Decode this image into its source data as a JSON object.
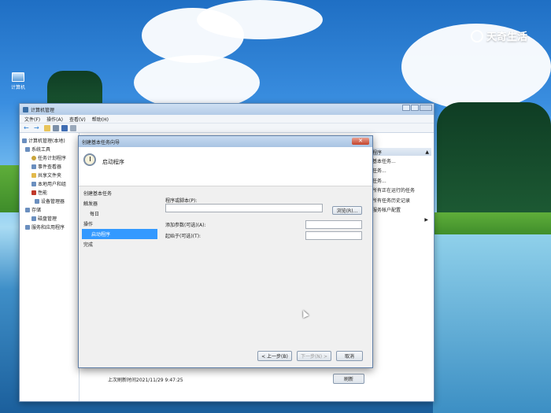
{
  "desktop": {
    "icon_label": "计算机"
  },
  "brand": {
    "text": "天奇生活"
  },
  "window": {
    "title": "计算机管理",
    "menu": [
      "文件(F)",
      "操作(A)",
      "查看(V)",
      "帮助(H)"
    ],
    "tree": [
      "计算机管理(本地)",
      "系统工具",
      "任务计划程序",
      "事件查看器",
      "共享文件夹",
      "本地用户和组",
      "性能",
      "设备管理器",
      "存储",
      "磁盘管理",
      "服务和应用程序"
    ],
    "actions": {
      "header": "程序",
      "items": [
        "基本任务...",
        "任务...",
        "任务...",
        "所有正在运行的任务",
        "所有任务历史记录",
        "服务帐户配置"
      ]
    },
    "last_refresh": "上次刷新时间2021/11/29 9:47:25",
    "refresh_button": "刷新"
  },
  "wizard": {
    "title": "创建基本任务向导",
    "heading": "启动程序",
    "steps": [
      "创建基本任务",
      "触发器",
      "每日",
      "操作",
      "启动程序",
      "完成"
    ],
    "program_label": "程序或脚本(P):",
    "program_value": "",
    "browse": "浏览(R)...",
    "args_label": "添加参数(可选)(A):",
    "args_value": "",
    "startin_label": "起始于(可选)(T):",
    "startin_value": "",
    "back": "< 上一步(B)",
    "next": "下一步(N) >",
    "cancel": "取消"
  }
}
